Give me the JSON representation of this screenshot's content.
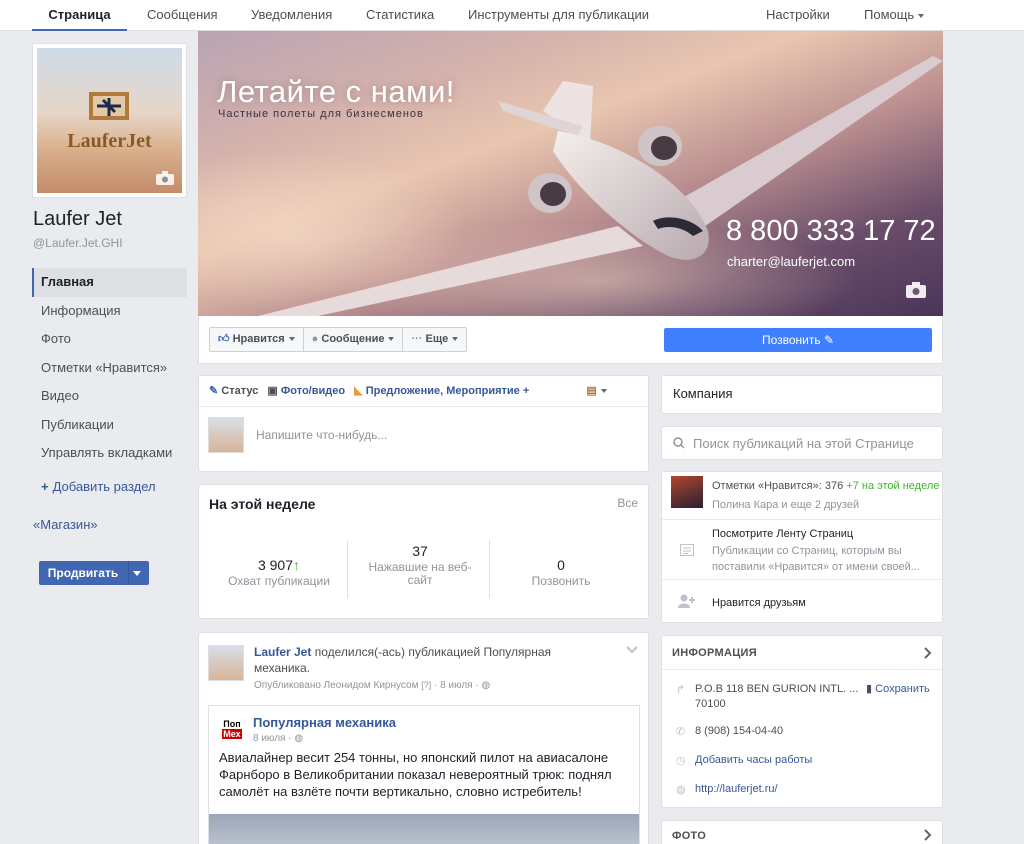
{
  "topnav": {
    "tabs": [
      "Страница",
      "Сообщения",
      "Уведомления",
      "Статистика",
      "Инструменты для публикации"
    ],
    "settings": "Настройки",
    "help": "Помощь"
  },
  "profile": {
    "logo_text": "LauferJet",
    "name": "Laufer Jet",
    "handle": "@Laufer.Jet.GHI"
  },
  "leftnav": {
    "items": [
      "Главная",
      "Информация",
      "Фото",
      "Отметки «Нравится»",
      "Видео",
      "Публикации",
      "Управлять вкладками"
    ],
    "add_section": "Добавить раздел",
    "shop": "«Магазин»",
    "promote": "Продвигать"
  },
  "cover": {
    "title": "Летайте с нами!",
    "subtitle": "Частные полеты для бизнесменов",
    "phone": "8 800 333 17 72",
    "email": "charter@lauferjet.com"
  },
  "actions": {
    "like": "Нравится",
    "message": "Сообщение",
    "more": "Еще",
    "call": "Позвонить"
  },
  "composer": {
    "tab_status": "Статус",
    "tab_photo": "Фото/видео",
    "tab_offer": "Предложение, Мероприятие +",
    "placeholder": "Напишите что-нибудь..."
  },
  "week": {
    "title": "На этой неделе",
    "all": "Все",
    "stats": [
      {
        "value": "3 907",
        "label1": "Охват публикации",
        "label2": ""
      },
      {
        "value": "37",
        "label1": "Нажавшие на веб-",
        "label2": "сайт"
      },
      {
        "value": "0",
        "label1": "Позвонить",
        "label2": ""
      }
    ]
  },
  "post": {
    "author": "Laufer Jet",
    "action": "поделился(-ась) публикацией Популярная механика.",
    "meta": "Опубликовано Леонидом Кирнусом",
    "date": "8 июля",
    "shared_logo_top": "Поп",
    "shared_logo_bottom": "Мех",
    "shared_name": "Популярная механика",
    "shared_date": "8 июля",
    "shared_text": "Авиалайнер весит 254 тонны, но японский пилот на авиасалоне Фарнборо в Великобритании показал невероятный трюк: поднял самолёт на взлёте почти вертикально, словно истребитель!"
  },
  "right": {
    "category": "Компания",
    "search_placeholder": "Поиск публикаций на этой Странице",
    "likes_text": "Отметки «Нравится»: 376",
    "likes_growth": "+7 на этой неделе",
    "likes_friends": "Полина Кара и еще 2 друзей",
    "feed_title": "Посмотрите Ленту Страниц",
    "feed_desc": "Публикации со Страниц, которым вы поставили «Нравится» от имени своей...",
    "friends_like": "Нравится друзьям",
    "info_title": "ИНФОРМАЦИЯ",
    "address1": "P.O.B 118 BEN GURION INTL. ...",
    "address2": "70100",
    "save": "Сохранить",
    "phone": "8 (908) 154-04-40",
    "hours": "Добавить часы работы",
    "website": "http://lauferjet.ru/",
    "photo_title": "ФОТО"
  }
}
